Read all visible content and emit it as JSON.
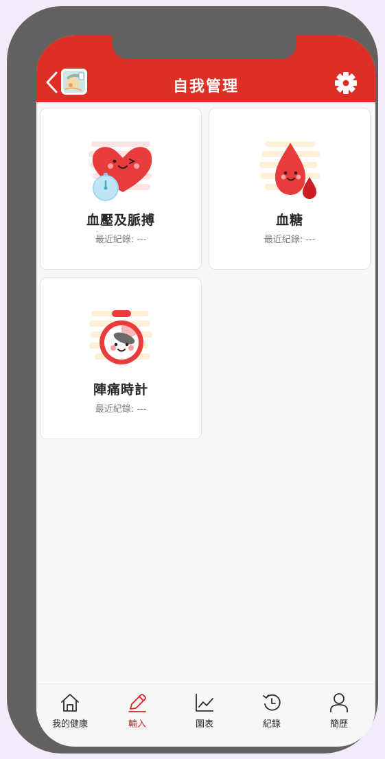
{
  "header": {
    "title": "自我管理",
    "back_icon": "chevron-left-icon",
    "settings_icon": "gear-icon",
    "bg_color": "#dc2f26"
  },
  "cards": [
    {
      "title": "血壓及脈搏",
      "subtitle": "最近紀錄: ---",
      "icon": "heart-stopwatch-icon"
    },
    {
      "title": "血糖",
      "subtitle": "最近紀錄: ---",
      "icon": "blood-drop-icon"
    },
    {
      "title": "陣痛時計",
      "subtitle": "最近紀錄: ---",
      "icon": "timer-icon"
    }
  ],
  "tabs": [
    {
      "label": "我的健康",
      "icon": "home-icon",
      "active": false
    },
    {
      "label": "輸入",
      "icon": "pencil-icon",
      "active": true
    },
    {
      "label": "圖表",
      "icon": "line-chart-icon",
      "active": false
    },
    {
      "label": "紀錄",
      "icon": "history-icon",
      "active": false
    },
    {
      "label": "簡歷",
      "icon": "user-icon",
      "active": false
    }
  ],
  "colors": {
    "accent": "#dc2f26",
    "active_tab": "#d4202a",
    "frame": "#646260"
  }
}
